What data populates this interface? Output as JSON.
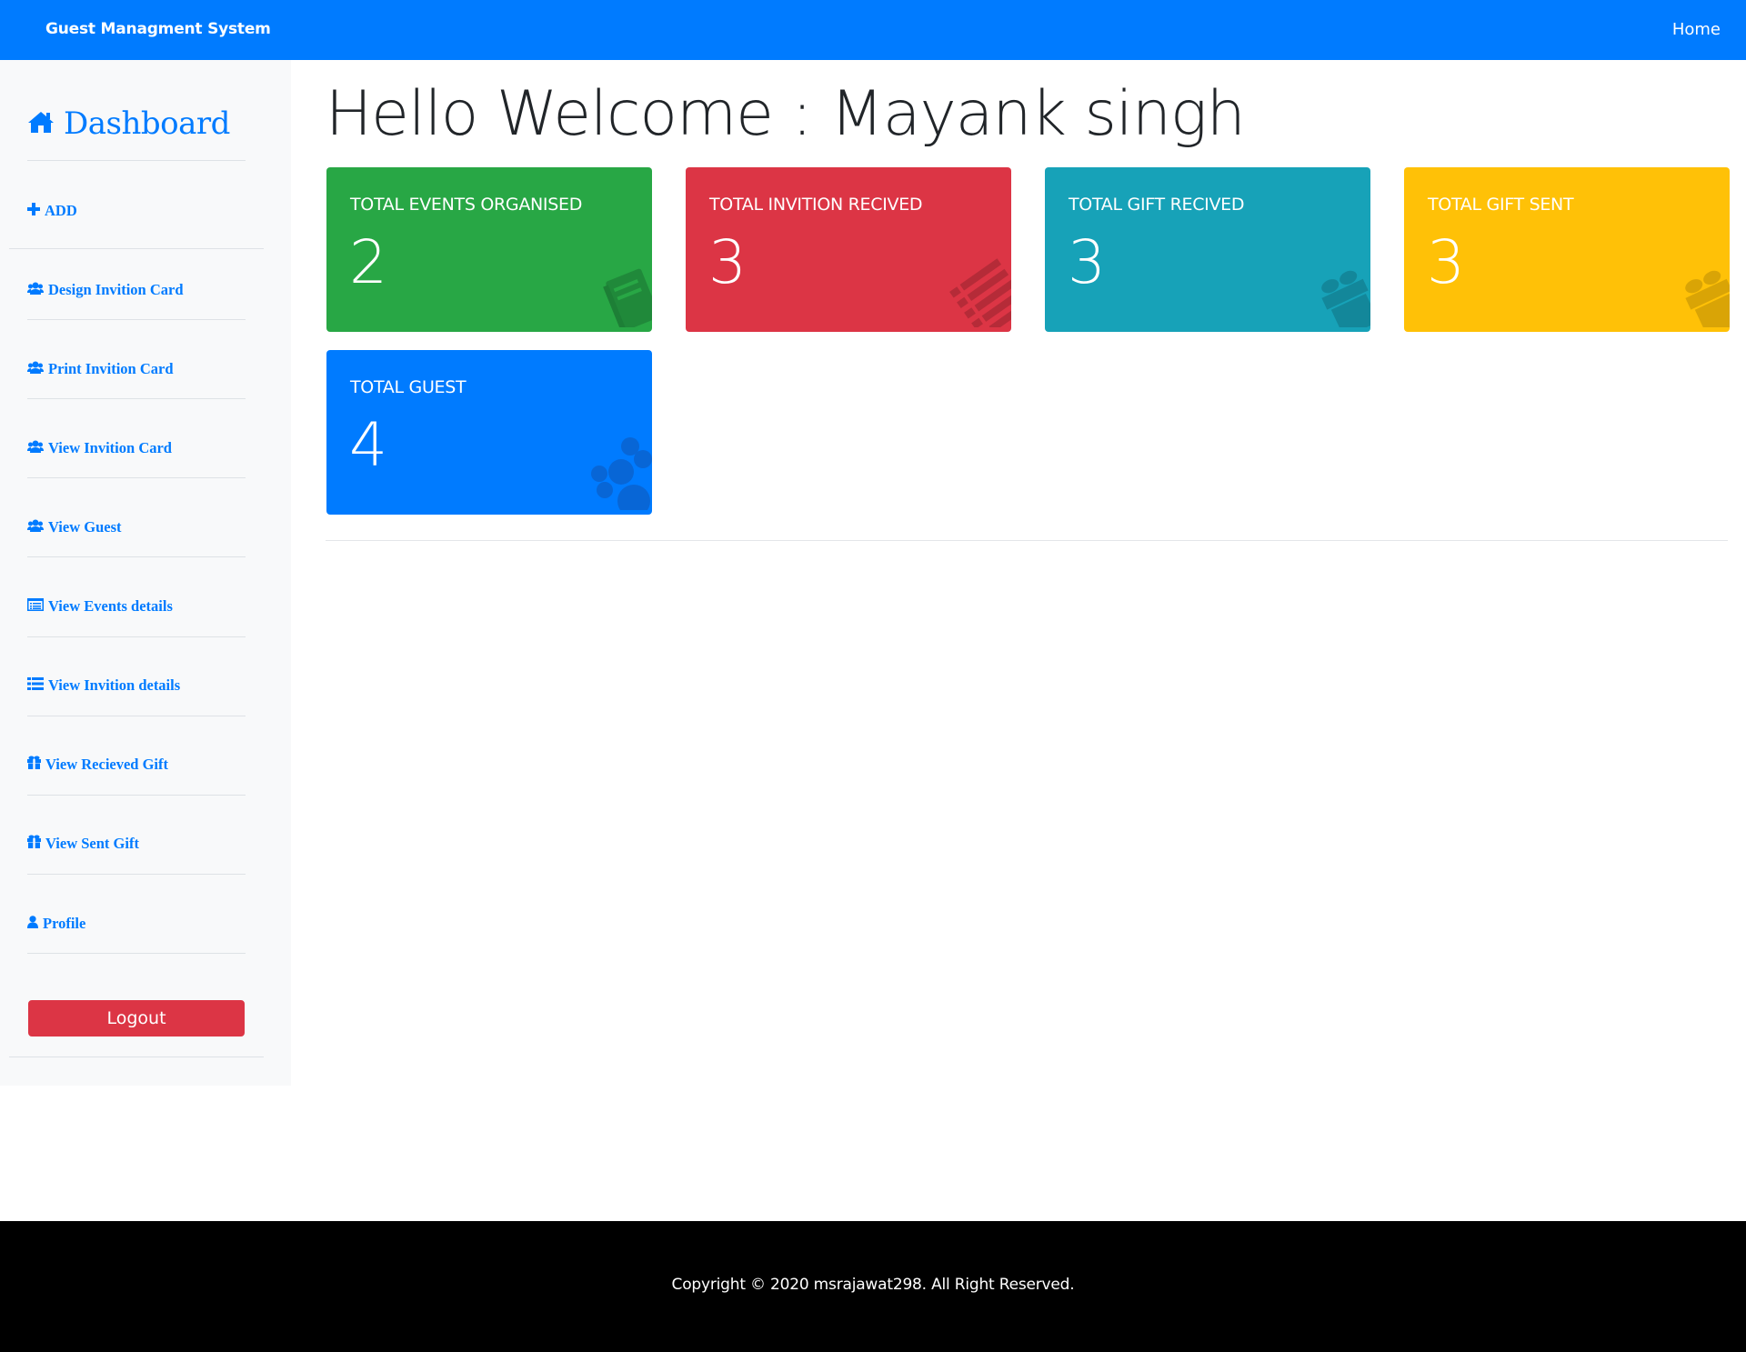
{
  "navbar": {
    "brand": "Guest Managment System",
    "home_link": "Home"
  },
  "sidebar": {
    "title": "Dashboard",
    "title_icon": "home-icon",
    "items": [
      {
        "label": "ADD",
        "icon": "plus-icon"
      },
      {
        "label": "Design Invition Card",
        "icon": "users-icon"
      },
      {
        "label": "Print Invition Card",
        "icon": "users-icon"
      },
      {
        "label": "View Invition Card",
        "icon": "users-icon"
      },
      {
        "label": "View Guest",
        "icon": "users-icon"
      },
      {
        "label": "View Events details",
        "icon": "list-alt-icon"
      },
      {
        "label": "View Invition details",
        "icon": "list-icon"
      },
      {
        "label": "View Recieved Gift",
        "icon": "gift-icon"
      },
      {
        "label": "View Sent Gift",
        "icon": "gift-icon"
      },
      {
        "label": "Profile",
        "icon": "user-icon"
      }
    ],
    "logout_label": "Logout"
  },
  "main": {
    "welcome": "Hello Welcome : Mayank singh",
    "cards": [
      {
        "title": "TOTAL EVENTS ORGANISED",
        "value": "2",
        "color": "#28a745",
        "icon": "book-icon"
      },
      {
        "title": "TOTAL INVITION RECIVED",
        "value": "3",
        "color": "#dc3545",
        "icon": "list-icon"
      },
      {
        "title": "TOTAL GIFT RECIVED",
        "value": "3",
        "color": "#17a2b8",
        "icon": "gift-icon"
      },
      {
        "title": "TOTAL GIFT SENT",
        "value": "3",
        "color": "#ffc107",
        "icon": "gift-icon"
      },
      {
        "title": "TOTAL GUEST",
        "value": "4",
        "color": "#007bff",
        "icon": "users-icon"
      }
    ]
  },
  "footer": {
    "copyright": "Copyright © 2020 msrajawat298. All Right Reserved."
  },
  "colors": {
    "primary": "#007bff",
    "danger": "#dc3545",
    "success": "#28a745",
    "info": "#17a2b8",
    "warning": "#ffc107",
    "sidebar_bg": "#f8f9fa",
    "footer_bg": "#000000"
  }
}
